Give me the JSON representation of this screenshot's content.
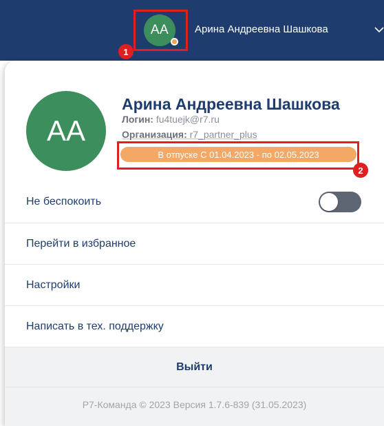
{
  "header": {
    "avatar_initials": "АА",
    "user_name": "Арина Андреевна Шашкова",
    "status_color": "#f0a450",
    "chevron_icon": "chevron-down-icon"
  },
  "profile": {
    "avatar_initials": "АА",
    "full_name": "Арина Андреевна Шашкова",
    "login_label": "Логин:",
    "login_value": "fu4tuejk@r7.ru",
    "org_label": "Организация:",
    "org_value": "r7_partner_plus",
    "vacation_text": "В отпуске С 01.04.2023 - по 02.05.2023"
  },
  "menu": {
    "do_not_disturb": "Не беспокоить",
    "do_not_disturb_on": false,
    "favorites": "Перейти в избранное",
    "settings": "Настройки",
    "support": "Написать в тех. поддержку",
    "logout": "Выйти"
  },
  "footer": {
    "text": "Р7-Команда © 2023 Версия 1.7.6-839 (31.05.2023)"
  },
  "annotations": {
    "marker_1": "1",
    "marker_2": "2"
  },
  "colors": {
    "header_bg": "#1f3c6e",
    "avatar_bg": "#3c8f5c",
    "vacation_bg": "#f3a865",
    "highlight": "#e02020"
  }
}
